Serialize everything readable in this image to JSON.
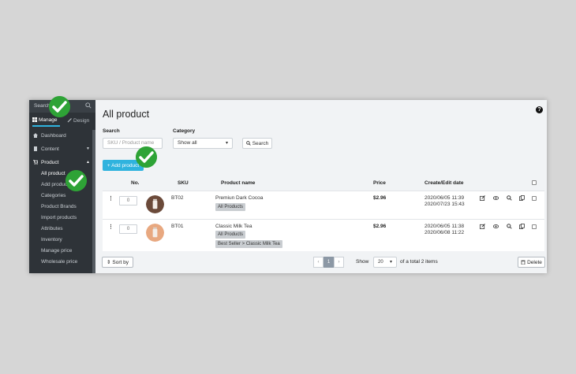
{
  "sidebar": {
    "search_label": "Search",
    "tabs": [
      {
        "label": "Manage",
        "icon": "grid-icon"
      },
      {
        "label": "Design",
        "icon": "brush-icon"
      }
    ],
    "menu": {
      "dashboard": "Dashboard",
      "content": "Content",
      "product": "Product",
      "sub_items": [
        "All product",
        "Add product",
        "Categories",
        "Product Brands",
        "Import products",
        "Attributes",
        "Inventory",
        "Manage price",
        "Wholesale price"
      ]
    }
  },
  "main": {
    "title": "All product",
    "help": "?",
    "search": {
      "label": "Search",
      "placeholder": "SKU / Product name"
    },
    "category": {
      "label": "Category",
      "selected": "Show all"
    },
    "search_button": "Search",
    "add_button": "+ Add product",
    "table": {
      "headers": {
        "no": "No.",
        "sku": "SKU",
        "name": "Product name",
        "price": "Price",
        "date": "Create/Edit date"
      },
      "rows": [
        {
          "no": "0",
          "sku": "BT02",
          "name": "Premiun Dark Cocoa",
          "tags": [
            "All Products"
          ],
          "price": "$2.96",
          "created": "2020/06/05 11:39",
          "edited": "2020/07/23 15:43",
          "thumb_color": "#6b4a3a"
        },
        {
          "no": "0",
          "sku": "BT01",
          "name": "Classic Milk Tea",
          "tags": [
            "All Products",
            "Best Seller > Classic Milk Tea"
          ],
          "price": "$2.96",
          "created": "2020/06/05 11:38",
          "edited": "2020/06/08 11:22",
          "thumb_color": "#e8a880"
        }
      ]
    },
    "footer": {
      "sort_by": "Sort by",
      "pager": {
        "prev": "‹",
        "current": "1",
        "next": "›"
      },
      "show_label": "Show",
      "page_size": "20",
      "total_text": "of a total 2 items",
      "delete": "Delete"
    }
  },
  "colors": {
    "accent": "#2fb3de",
    "sidebar": "#2e3338",
    "check": "#2ea336"
  }
}
